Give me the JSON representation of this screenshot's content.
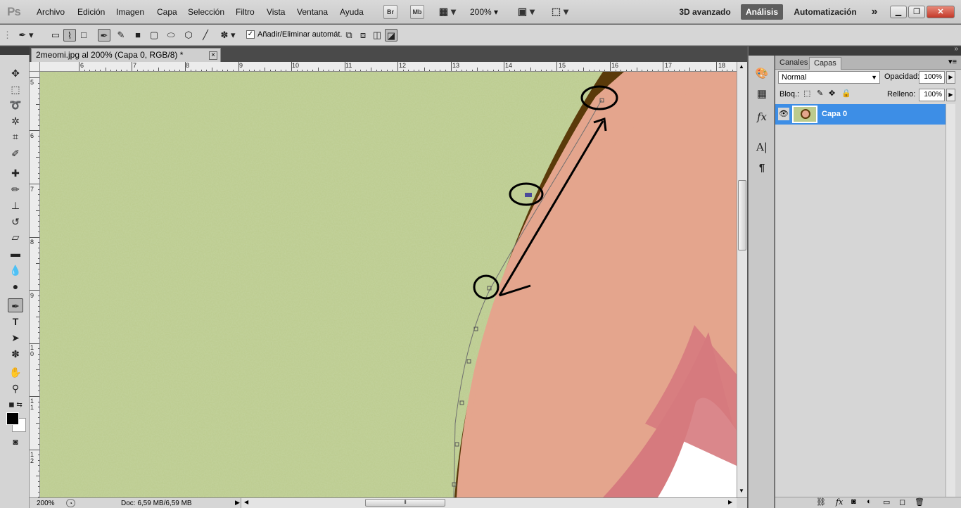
{
  "app": {
    "logo": "Ps"
  },
  "menu": [
    "Archivo",
    "Edición",
    "Imagen",
    "Capa",
    "Selección",
    "Filtro",
    "Vista",
    "Ventana",
    "Ayuda"
  ],
  "appbar": {
    "br": "Br",
    "mb": "Mb",
    "zoom": "200%"
  },
  "workspaces": {
    "ws1": "3D avanzado",
    "ws2": "Análisis",
    "ws3": "Automatización",
    "more": "»"
  },
  "options": {
    "auto_add_delete": "Añadir/Eliminar automát."
  },
  "document": {
    "tab_title": "2meomi.jpg al 200% (Capa 0, RGB/8) *",
    "close": "×"
  },
  "rulers": {
    "top": [
      "6",
      "7",
      "8",
      "9",
      "10",
      "11",
      "12",
      "13",
      "14",
      "15",
      "16",
      "17",
      "18"
    ],
    "left": [
      "5",
      "6",
      "7",
      "8",
      "9",
      "1\n0",
      "1\n1",
      "1\n2"
    ]
  },
  "status": {
    "zoom": "200%",
    "doc": "Doc: 6,59 MB/6,59 MB"
  },
  "panel": {
    "tabs": [
      "Canales",
      "Capas"
    ],
    "blend_mode": "Normal",
    "opacity_label": "Opacidad:",
    "opacity": "100%",
    "lock_label": "Bloq.:",
    "fill_label": "Relleno:",
    "fill": "100%",
    "layer_name": "Capa 0"
  },
  "colors": {
    "background_green": "#b9c98a",
    "brown": "#5a3a0a",
    "skin": "#e4a58d",
    "pink": "#d67a7e",
    "selected": "#3d8ee6"
  }
}
